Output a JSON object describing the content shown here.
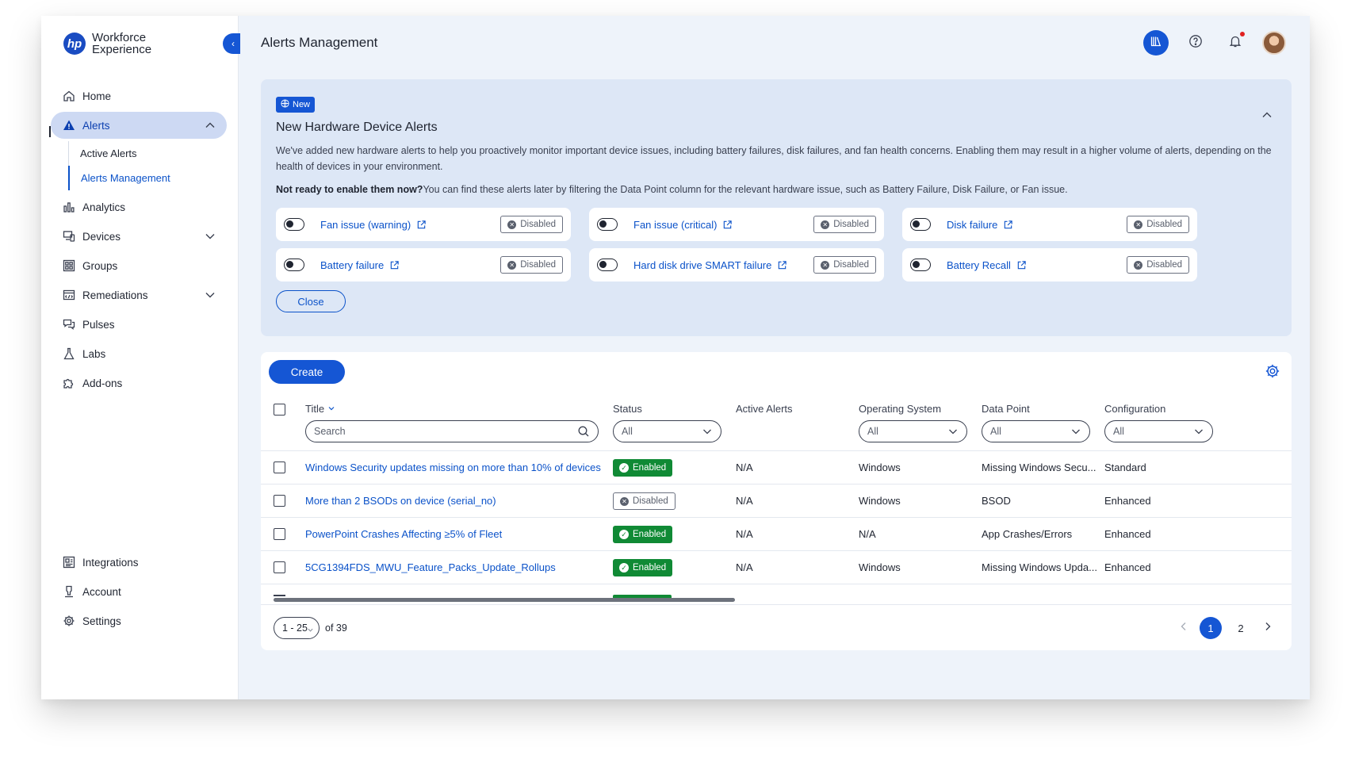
{
  "app": {
    "brand_line1": "Workforce",
    "brand_line2": "Experience",
    "logo_text": "hp",
    "page_title": "Alerts Management"
  },
  "sidebar": {
    "items": [
      {
        "label": "Home",
        "icon": "home-icon"
      },
      {
        "label": "Alerts",
        "icon": "alert-triangle-icon",
        "active": true,
        "expanded": true
      },
      {
        "label": "Analytics",
        "icon": "bar-chart-icon"
      },
      {
        "label": "Devices",
        "icon": "devices-icon",
        "expandable": true
      },
      {
        "label": "Groups",
        "icon": "grid-icon"
      },
      {
        "label": "Remediations",
        "icon": "remediations-icon",
        "expandable": true
      },
      {
        "label": "Pulses",
        "icon": "chat-bubbles-icon"
      },
      {
        "label": "Labs",
        "icon": "flask-icon"
      },
      {
        "label": "Add-ons",
        "icon": "puzzle-icon"
      }
    ],
    "alerts_sub": [
      "Active Alerts",
      "Alerts Management"
    ],
    "bottom": [
      {
        "label": "Integrations",
        "icon": "integrations-icon"
      },
      {
        "label": "Account",
        "icon": "account-icon"
      },
      {
        "label": "Settings",
        "icon": "gear-icon"
      }
    ]
  },
  "banner": {
    "badge": "New",
    "title": "New Hardware Device Alerts",
    "description": "We've added new hardware alerts to help you proactively monitor important device issues, including battery failures, disk failures, and fan health concerns. Enabling them may result in a higher volume of alerts, depending on the health of devices in your environment.",
    "note_bold": "Not ready to enable them now?",
    "note_rest": "You can find these alerts later by filtering the Data Point column for the relevant hardware issue, such as Battery Failure, Disk Failure, or Fan issue.",
    "alerts": [
      {
        "label": "Fan issue (warning)",
        "status": "Disabled"
      },
      {
        "label": "Fan issue (critical)",
        "status": "Disabled"
      },
      {
        "label": "Disk failure",
        "status": "Disabled"
      },
      {
        "label": "Battery failure",
        "status": "Disabled"
      },
      {
        "label": "Hard disk drive SMART failure",
        "status": "Disabled"
      },
      {
        "label": "Battery Recall",
        "status": "Disabled"
      }
    ],
    "close_label": "Close"
  },
  "table": {
    "create_label": "Create",
    "columns": {
      "title": "Title",
      "status": "Status",
      "active_alerts": "Active Alerts",
      "os": "Operating System",
      "data_point": "Data Point",
      "configuration": "Configuration"
    },
    "filters": {
      "search_placeholder": "Search",
      "status": "All",
      "os": "All",
      "data_point": "All",
      "configuration": "All"
    },
    "rows": [
      {
        "title": "Windows Security updates missing on more than 10% of devices",
        "status": "Enabled",
        "active_alerts": "N/A",
        "os": "Windows",
        "data_point": "Missing Windows Secu...",
        "configuration": "Standard"
      },
      {
        "title": "More than 2 BSODs on device (serial_no)",
        "status": "Disabled",
        "active_alerts": "N/A",
        "os": "Windows",
        "data_point": "BSOD",
        "configuration": "Enhanced"
      },
      {
        "title": "PowerPoint Crashes Affecting ≥5% of Fleet",
        "status": "Enabled",
        "active_alerts": "N/A",
        "os": "N/A",
        "data_point": "App Crashes/Errors",
        "configuration": "Enhanced"
      },
      {
        "title": "5CG1394FDS_MWU_Feature_Packs_Update_Rollups",
        "status": "Enabled",
        "active_alerts": "N/A",
        "os": "Windows",
        "data_point": "Missing Windows Upda...",
        "configuration": "Enhanced"
      }
    ]
  },
  "pagination": {
    "range": "1 - 25",
    "total": "of 39",
    "pages": [
      "1",
      "2"
    ],
    "current": "1"
  },
  "colors": {
    "primary": "#1556d4",
    "enabled": "#108a35",
    "link": "#0b52c9"
  }
}
